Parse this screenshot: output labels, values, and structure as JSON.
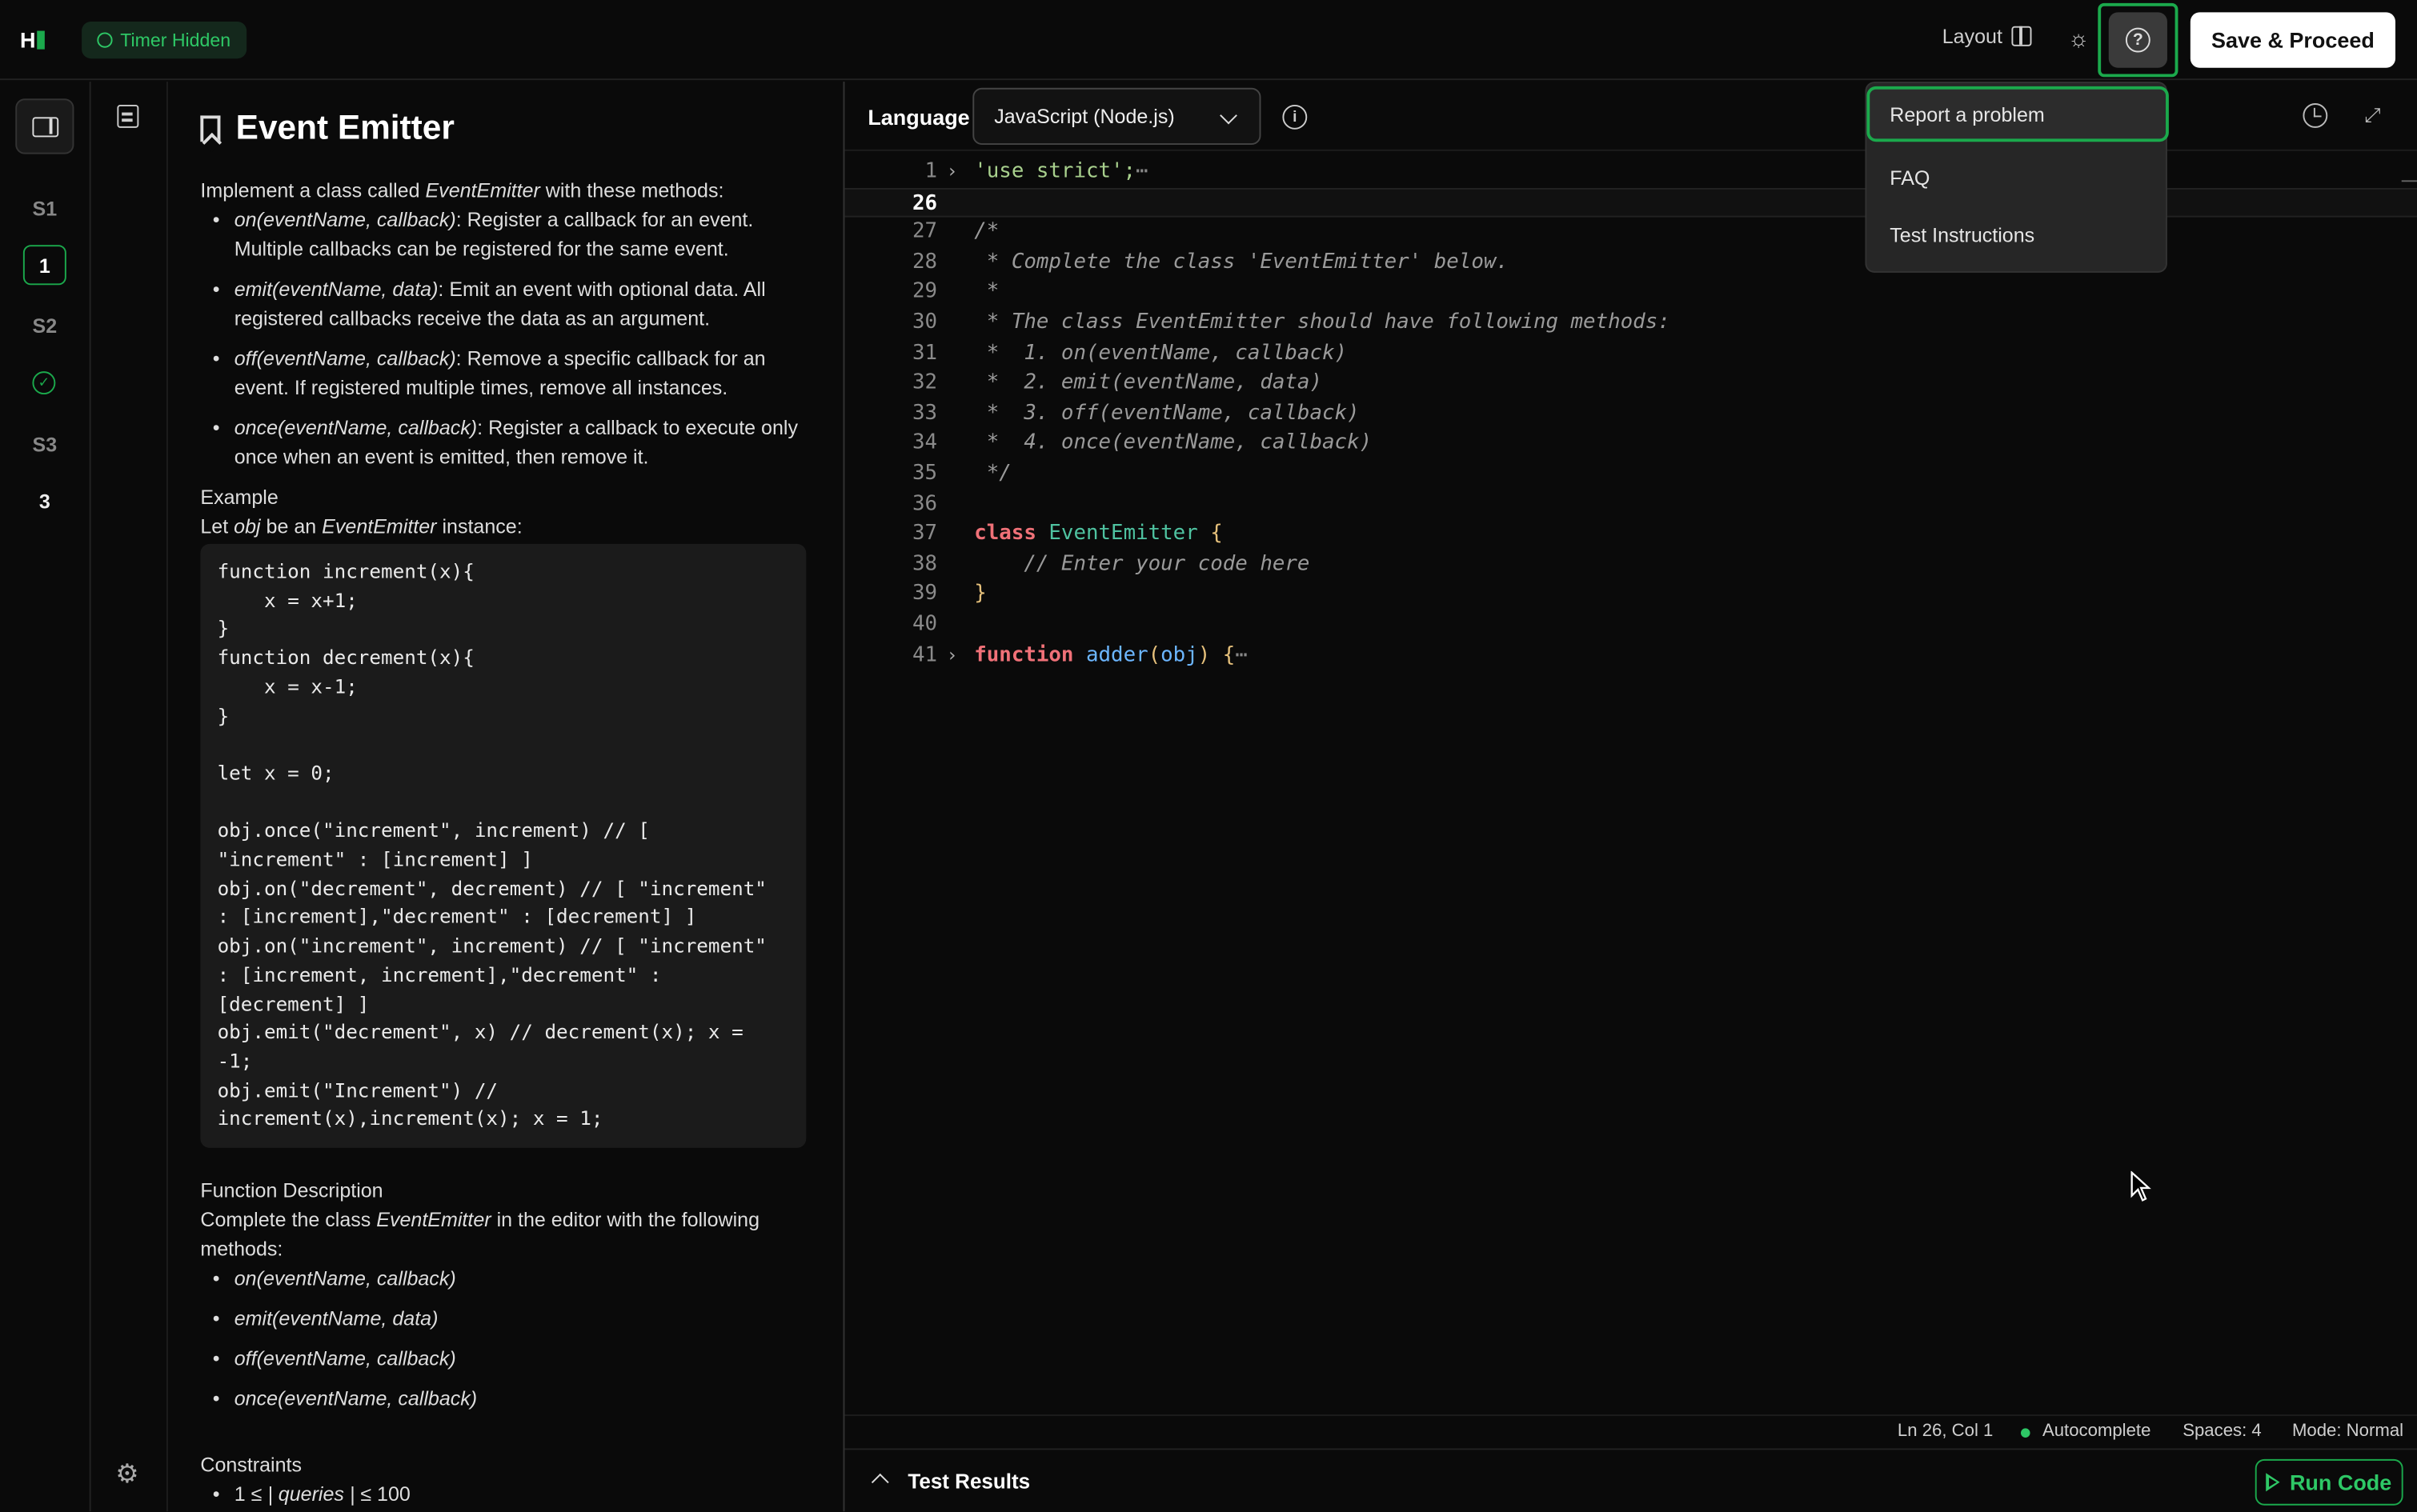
{
  "header": {
    "logo_letter": "H",
    "timer_label": "Timer Hidden",
    "layout_label": "Layout",
    "save_label": "Save & Proceed",
    "icons": [
      "clock-icon",
      "layout-icon",
      "sun-icon",
      "help-icon"
    ]
  },
  "help_menu": {
    "items": [
      {
        "label": "Report a problem"
      },
      {
        "label": "FAQ"
      },
      {
        "label": "Test Instructions"
      }
    ]
  },
  "rail": {
    "items": [
      {
        "label": "S1"
      },
      {
        "label": "1"
      },
      {
        "label": "S2"
      },
      {
        "label": "S3"
      },
      {
        "label": "3"
      }
    ]
  },
  "problem": {
    "title": "Event Emitter",
    "intro_prefix": "Implement a class called ",
    "intro_class": "EventEmitter",
    "intro_suffix": " with these methods:",
    "methods": [
      {
        "sig": "on(eventName, callback)",
        "desc": ": Register a callback for an event. Multiple callbacks can be registered for the same event."
      },
      {
        "sig": "emit(eventName, data)",
        "desc": ": Emit an event with optional data. All registered callbacks receive the data as an argument."
      },
      {
        "sig": "off(eventName, callback)",
        "desc": ": Remove a specific callback for an event. If registered multiple times, remove all instances."
      },
      {
        "sig": "once(eventName, callback)",
        "desc": ": Register a callback to execute only once when an event is emitted, then remove it."
      }
    ],
    "example_heading": "Example",
    "example_let": "Let ",
    "example_obj": "obj",
    "example_be": " be an ",
    "example_cls": "EventEmitter",
    "example_inst": " instance:",
    "example_code": "function increment(x){\n    x = x+1;\n}\nfunction decrement(x){\n    x = x-1;\n}\n\nlet x = 0;\n\nobj.once(\"increment\", increment) // [ \"increment\" : [increment] ]\nobj.on(\"decrement\", decrement) // [ \"increment\" : [increment],\"decrement\" : [decrement] ]\nobj.on(\"increment\", increment) // [ \"increment\" : [increment, increment],\"decrement\" : [decrement] ]\nobj.emit(\"decrement\", x) // decrement(x); x = -1;\nobj.emit(\"Increment\") // increment(x),increment(x); x = 1;",
    "fd_heading": "Function Description",
    "fd_prefix": "Complete the class ",
    "fd_cls": "EventEmitter",
    "fd_suffix": " in the editor with the following methods:",
    "fd_methods": [
      "on(eventName, callback)",
      "emit(eventName, data)",
      "off(eventName, callback)",
      "once(eventName, callback)"
    ],
    "constraints_heading": "Constraints",
    "constraint_pre": "1 ≤ ",
    "constraint_mid": "| queries |",
    "constraint_post": " ≤ 100"
  },
  "editor": {
    "language_label": "Language",
    "language_value": "JavaScript (Node.js)",
    "lines": [
      {
        "n": "1",
        "fold": true,
        "parts": [
          [
            "c-str",
            "'use strict';"
          ],
          [
            "c-dots",
            "⋯"
          ]
        ]
      },
      {
        "n": "26",
        "active": true,
        "parts": []
      },
      {
        "n": "27",
        "parts": [
          [
            "c-com",
            "/*"
          ]
        ]
      },
      {
        "n": "28",
        "parts": [
          [
            "c-com",
            " * Complete the class 'EventEmitter' below."
          ]
        ]
      },
      {
        "n": "29",
        "parts": [
          [
            "c-com",
            " *"
          ]
        ]
      },
      {
        "n": "30",
        "parts": [
          [
            "c-com",
            " * The class EventEmitter should have following methods:"
          ]
        ]
      },
      {
        "n": "31",
        "parts": [
          [
            "c-com",
            " *  1. on(eventName, callback)"
          ]
        ]
      },
      {
        "n": "32",
        "parts": [
          [
            "c-com",
            " *  2. emit(eventName, data)"
          ]
        ]
      },
      {
        "n": "33",
        "parts": [
          [
            "c-com",
            " *  3. off(eventName, callback)"
          ]
        ]
      },
      {
        "n": "34",
        "parts": [
          [
            "c-com",
            " *  4. once(eventName, callback)"
          ]
        ]
      },
      {
        "n": "35",
        "parts": [
          [
            "c-com",
            " */"
          ]
        ]
      },
      {
        "n": "36",
        "parts": []
      },
      {
        "n": "37",
        "parts": [
          [
            "c-kw",
            "class"
          ],
          [
            "",
            " "
          ],
          [
            "c-cls",
            "EventEmitter"
          ],
          [
            "",
            " "
          ],
          [
            "c-br",
            "{"
          ]
        ]
      },
      {
        "n": "38",
        "parts": [
          [
            "c-com",
            "    // Enter your code here"
          ]
        ]
      },
      {
        "n": "39",
        "parts": [
          [
            "c-br",
            "}"
          ]
        ]
      },
      {
        "n": "40",
        "parts": []
      },
      {
        "n": "41",
        "fold": true,
        "parts": [
          [
            "c-kw",
            "function"
          ],
          [
            "",
            " "
          ],
          [
            "c-fn",
            "adder"
          ],
          [
            "c-br",
            "("
          ],
          [
            "c-fn",
            "obj"
          ],
          [
            "c-br",
            ")"
          ],
          [
            "",
            " "
          ],
          [
            "c-br",
            "{"
          ],
          [
            "c-dots",
            "⋯"
          ]
        ]
      }
    ]
  },
  "status": {
    "position": "Ln 26, Col 1",
    "autocomplete": "Autocomplete",
    "spaces": "Spaces: 4",
    "mode": "Mode: Normal"
  },
  "results": {
    "label": "Test Results",
    "run_label": "Run Code"
  },
  "colors": {
    "accent": "#1ba94c",
    "background": "#0a0a0a"
  }
}
